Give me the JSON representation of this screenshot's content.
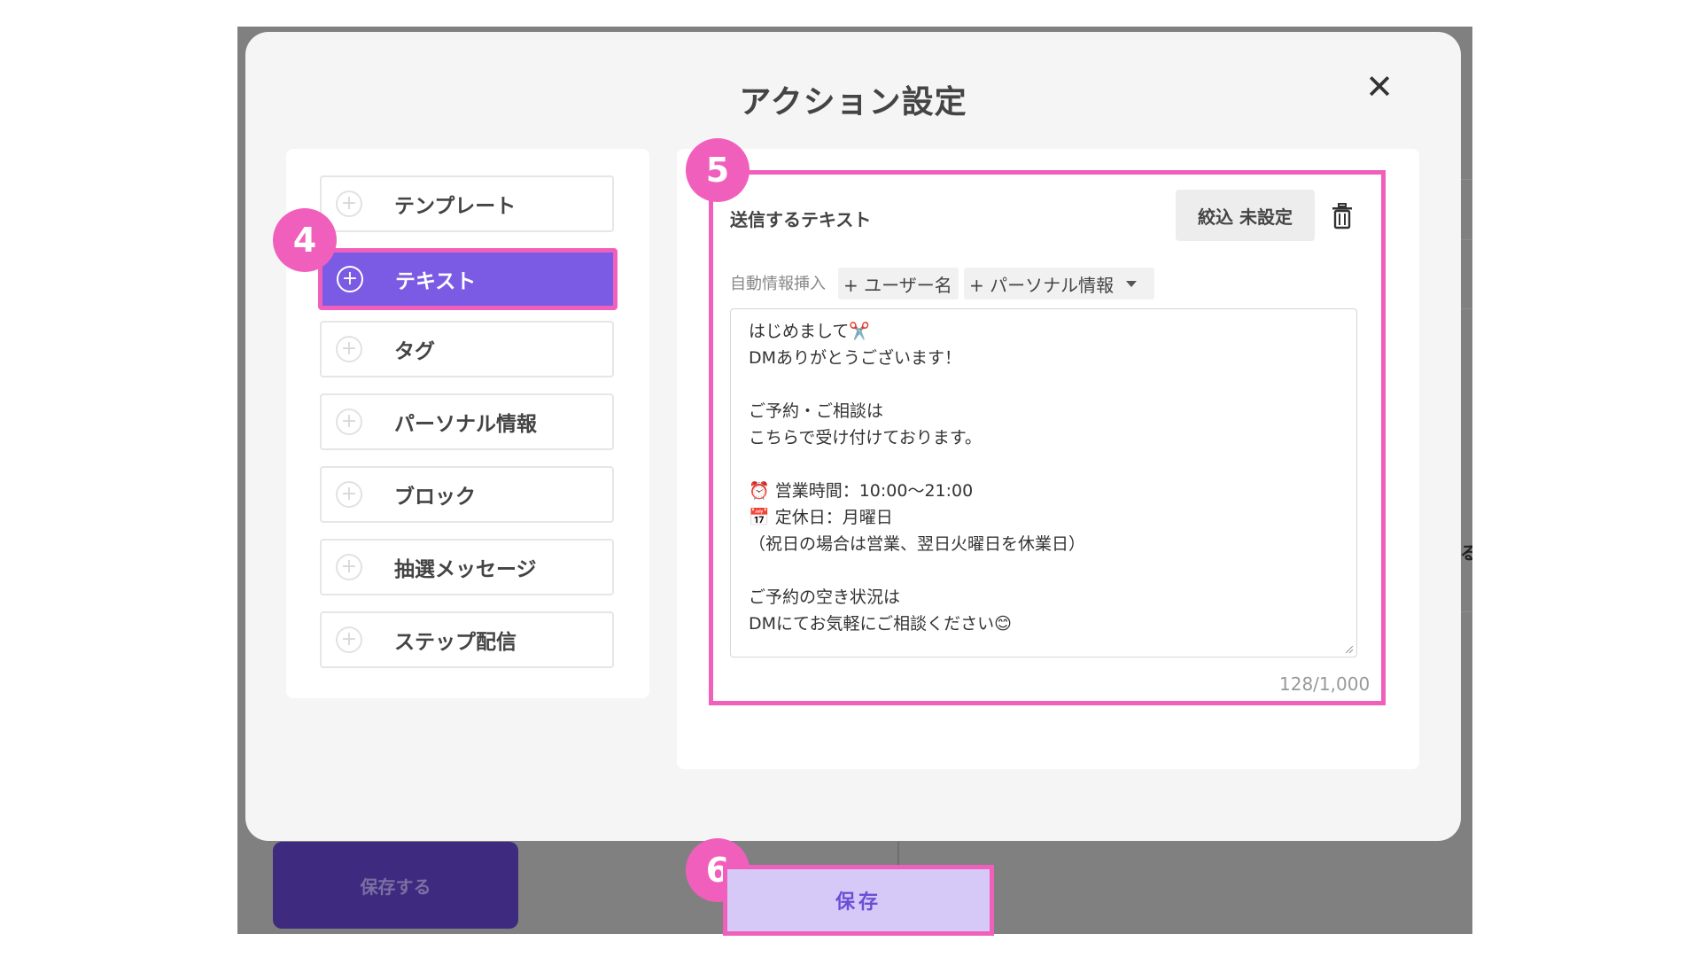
{
  "modal": {
    "title": "アクション設定",
    "close_icon": "close-icon"
  },
  "menu": {
    "items": [
      {
        "label": "テンプレート",
        "active": false
      },
      {
        "label": "テキスト",
        "active": true
      },
      {
        "label": "タグ",
        "active": false
      },
      {
        "label": "パーソナル情報",
        "active": false
      },
      {
        "label": "ブロック",
        "active": false
      },
      {
        "label": "抽選メッセージ",
        "active": false
      },
      {
        "label": "ステップ配信",
        "active": false
      }
    ]
  },
  "text_section": {
    "title": "送信するテキスト",
    "filter_label": "絞込 未設定",
    "insert_label": "自動情報挿入",
    "insert_user": "+ ユーザー名",
    "insert_personal": "+ パーソナル情報",
    "lines": [
      "はじめまして✂️",
      "DMありがとうございます！",
      "",
      "ご予約・ご相談は",
      "こちらで受け付けております。",
      "",
      "⏰ 営業時間：10:00〜21:00",
      "📅 定休日：月曜日",
      "（祝日の場合は営業、翌日火曜日を休業日）",
      "",
      "ご予約の空き状況は",
      "DMにてお気軽にご相談ください😊"
    ],
    "counter": "128/1,000"
  },
  "badges": {
    "step4": "4",
    "step5": "5",
    "step6": "6"
  },
  "background": {
    "save_label": "保存する",
    "edge_char": "る"
  },
  "footer": {
    "save_label": "保存"
  },
  "colors": {
    "accent_purple": "#7b5be4",
    "highlight_pink": "#f15fbc",
    "save_bg": "#d6c8f7"
  }
}
